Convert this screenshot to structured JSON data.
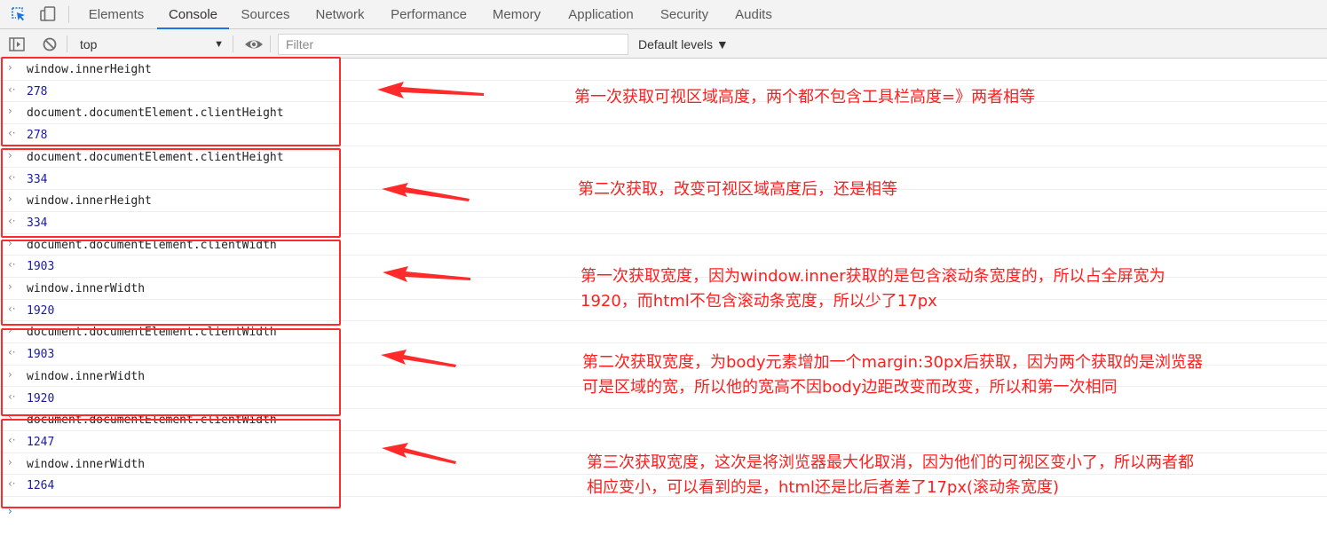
{
  "tabs": {
    "items": [
      {
        "label": "Elements"
      },
      {
        "label": "Console"
      },
      {
        "label": "Sources"
      },
      {
        "label": "Network"
      },
      {
        "label": "Performance"
      },
      {
        "label": "Memory"
      },
      {
        "label": "Application"
      },
      {
        "label": "Security"
      },
      {
        "label": "Audits"
      }
    ],
    "active": "Console"
  },
  "icons": {
    "inspect": "inspect-element-icon",
    "device": "device-toolbar-icon",
    "sidebar": "show-sidebar-icon",
    "clear": "clear-console-icon",
    "eye": "live-expression-eye-icon",
    "context_arrow": "dropdown-triangle-icon"
  },
  "toolbar": {
    "context": "top",
    "context_arrow": "▼",
    "filter_placeholder": "Filter",
    "levels": "Default levels ▼"
  },
  "console": {
    "input_symbol": "›",
    "result_symbol": "‹·",
    "prompt_symbol": "›",
    "rows": [
      {
        "kind": "input",
        "text": "window.innerHeight"
      },
      {
        "kind": "result",
        "text": "278"
      },
      {
        "kind": "input",
        "text": "document.documentElement.clientHeight"
      },
      {
        "kind": "result",
        "text": "278"
      },
      {
        "kind": "input",
        "text": "document.documentElement.clientHeight"
      },
      {
        "kind": "result",
        "text": "334"
      },
      {
        "kind": "input",
        "text": "window.innerHeight"
      },
      {
        "kind": "result",
        "text": "334"
      },
      {
        "kind": "input",
        "text": "document.documentElement.clientWidth"
      },
      {
        "kind": "result",
        "text": "1903"
      },
      {
        "kind": "input",
        "text": "window.innerWidth"
      },
      {
        "kind": "result",
        "text": "1920"
      },
      {
        "kind": "input",
        "text": "document.documentElement.clientWidth"
      },
      {
        "kind": "result",
        "text": "1903"
      },
      {
        "kind": "input",
        "text": "window.innerWidth"
      },
      {
        "kind": "result",
        "text": "1920"
      },
      {
        "kind": "input",
        "text": "document.documentElement.clientWidth"
      },
      {
        "kind": "result",
        "text": "1247"
      },
      {
        "kind": "input",
        "text": "window.innerWidth"
      },
      {
        "kind": "result",
        "text": "1264"
      }
    ]
  },
  "annotations": {
    "color": "#ff1e1e",
    "notes": [
      {
        "lines": [
          "第一次获取可视区域高度，两个都不包含工具栏高度=》两者相等"
        ]
      },
      {
        "lines": [
          "第二次获取，改变可视区域高度后，还是相等"
        ]
      },
      {
        "lines": [
          "第一次获取宽度，因为window.inner获取的是包含滚动条宽度的，所以占全屏宽为",
          "1920，而html不包含滚动条宽度，所以少了17px"
        ]
      },
      {
        "lines": [
          "第二次获取宽度，为body元素增加一个margin:30px后获取，因为两个获取的是浏览器",
          "可是区域的宽，所以他的宽高不因body边距改变而改变，所以和第一次相同"
        ]
      },
      {
        "lines": [
          "第三次获取宽度，这次是将浏览器最大化取消，因为他们的可视区变小了，所以两者都",
          "相应变小，可以看到的是，html还是比后者差了17px(滚动条宽度)"
        ]
      }
    ]
  }
}
